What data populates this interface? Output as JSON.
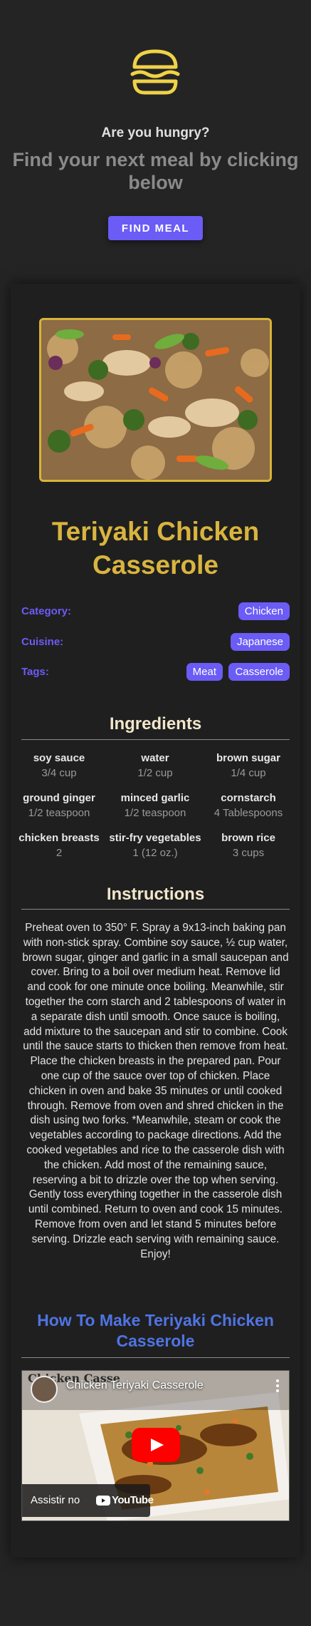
{
  "hero": {
    "question": "Are you hungry?",
    "subtitle": "Find your next meal by clicking below",
    "button_label": "FIND MEAL"
  },
  "meal": {
    "title": "Teriyaki Chicken Casserole",
    "category_label": "Category:",
    "category": "Chicken",
    "cuisine_label": "Cuisine:",
    "cuisine": "Japanese",
    "tags_label": "Tags:",
    "tags": [
      "Meat",
      "Casserole"
    ]
  },
  "ingredients": {
    "title": "Ingredients",
    "items": [
      {
        "name": "soy sauce",
        "amount": "3/4 cup"
      },
      {
        "name": "water",
        "amount": "1/2 cup"
      },
      {
        "name": "brown sugar",
        "amount": "1/4 cup"
      },
      {
        "name": "ground ginger",
        "amount": "1/2 teaspoon"
      },
      {
        "name": "minced garlic",
        "amount": "1/2 teaspoon"
      },
      {
        "name": "cornstarch",
        "amount": "4 Tablespoons"
      },
      {
        "name": "chicken breasts",
        "amount": "2"
      },
      {
        "name": "stir-fry vegetables",
        "amount": "1 (12 oz.)"
      },
      {
        "name": "brown rice",
        "amount": "3 cups"
      }
    ]
  },
  "instructions": {
    "title": "Instructions",
    "text": "Preheat oven to 350° F. Spray a 9x13-inch baking pan with non-stick spray. Combine soy sauce, ½ cup water, brown sugar, ginger and garlic in a small saucepan and cover. Bring to a boil over medium heat. Remove lid and cook for one minute once boiling. Meanwhile, stir together the corn starch and 2 tablespoons of water in a separate dish until smooth. Once sauce is boiling, add mixture to the saucepan and stir to combine. Cook until the sauce starts to thicken then remove from heat. Place the chicken breasts in the prepared pan. Pour one cup of the sauce over top of chicken. Place chicken in oven and bake 35 minutes or until cooked through. Remove from oven and shred chicken in the dish using two forks. *Meanwhile, steam or cook the vegetables according to package directions. Add the cooked vegetables and rice to the casserole dish with the chicken. Add most of the remaining sauce, reserving a bit to drizzle over the top when serving. Gently toss everything together in the casserole dish until combined. Return to oven and cook 15 minutes. Remove from oven and let stand 5 minutes before serving. Drizzle each serving with remaining sauce. Enjoy!"
  },
  "video": {
    "section_title": "How To Make Teriyaki Chicken Casserole",
    "title": "Chicken Teriyaki Casserole",
    "channel_overlay": "Chicken Casse",
    "watch_on": "Assistir no",
    "platform": "YouTube"
  },
  "colors": {
    "accent": "#6b5cf6",
    "gold": "#d9b43f",
    "link_blue": "#4f74e4",
    "background": "#242424"
  }
}
